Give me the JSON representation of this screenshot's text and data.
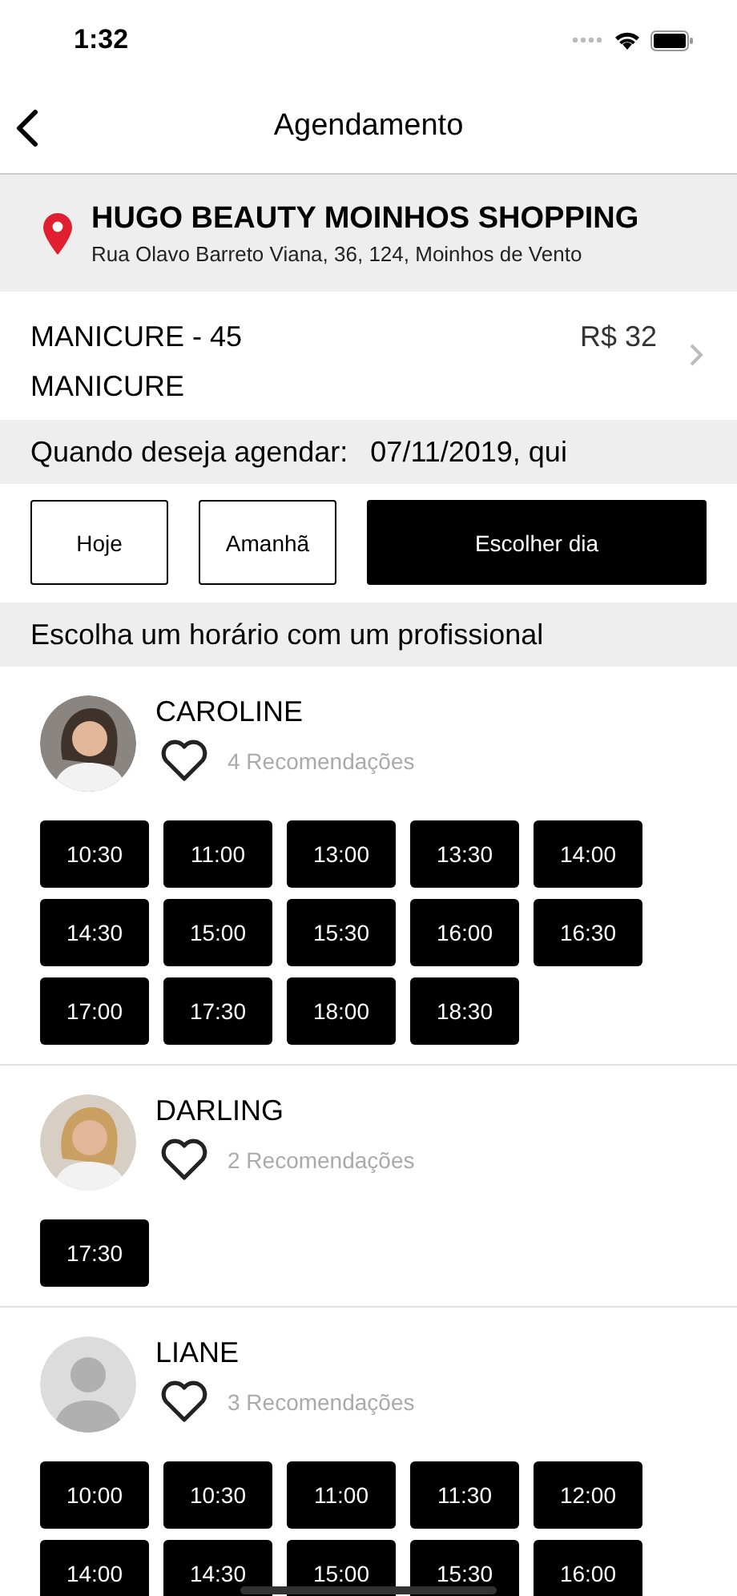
{
  "status_bar": {
    "time": "1:32"
  },
  "nav": {
    "title": "Agendamento"
  },
  "location": {
    "name": "HUGO BEAUTY MOINHOS SHOPPING",
    "address": "Rua Olavo Barreto Viana, 36, 124, Moinhos de Vento"
  },
  "service": {
    "name": "MANICURE - 45",
    "category": "MANICURE",
    "price": "R$ 32"
  },
  "date_bar": {
    "label": "Quando deseja agendar:",
    "value": "07/11/2019, qui"
  },
  "day_buttons": [
    {
      "label": "Hoje",
      "selected": false
    },
    {
      "label": "Amanhã",
      "selected": false
    },
    {
      "label": "Escolher dia",
      "selected": true
    }
  ],
  "section_title": "Escolha um horário com um profissional",
  "professionals": [
    {
      "name": "CAROLINE",
      "kind": "photo",
      "recommendations": "4 Recomendações",
      "times": [
        "10:30",
        "11:00",
        "13:00",
        "13:30",
        "14:00",
        "14:30",
        "15:00",
        "15:30",
        "16:00",
        "16:30",
        "17:00",
        "17:30",
        "18:00",
        "18:30"
      ]
    },
    {
      "name": "DARLING",
      "kind": "photo",
      "recommendations": "2 Recomendações",
      "times": [
        "17:30"
      ]
    },
    {
      "name": "LIANE",
      "kind": "placeholder",
      "recommendations": "3 Recomendações",
      "times": [
        "10:00",
        "10:30",
        "11:00",
        "11:30",
        "12:00",
        "14:00",
        "14:30",
        "15:00",
        "15:30",
        "16:00"
      ]
    }
  ]
}
